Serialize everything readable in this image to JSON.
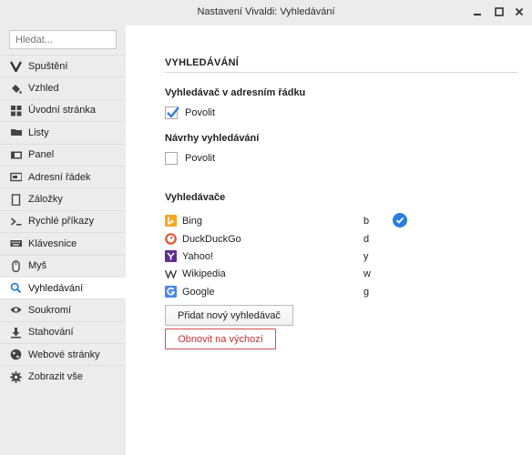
{
  "window": {
    "title": "Nastavení Vivaldi: Vyhledávání"
  },
  "search": {
    "placeholder": "Hledat..."
  },
  "sidebar": {
    "items": [
      {
        "label": "Spuštění",
        "icon": "vivaldi-icon"
      },
      {
        "label": "Vzhled",
        "icon": "paint-bucket-icon"
      },
      {
        "label": "Úvodní stránka",
        "icon": "grid-icon"
      },
      {
        "label": "Listy",
        "icon": "tabs-icon"
      },
      {
        "label": "Panel",
        "icon": "panel-icon"
      },
      {
        "label": "Adresní řádek",
        "icon": "address-bar-icon"
      },
      {
        "label": "Záložky",
        "icon": "bookmark-icon"
      },
      {
        "label": "Rychlé příkazy",
        "icon": "quick-commands-icon"
      },
      {
        "label": "Klávesnice",
        "icon": "keyboard-icon"
      },
      {
        "label": "Myš",
        "icon": "mouse-icon"
      },
      {
        "label": "Vyhledávání",
        "icon": "search-icon",
        "active": true
      },
      {
        "label": "Soukromí",
        "icon": "eye-icon"
      },
      {
        "label": "Stahování",
        "icon": "download-icon"
      },
      {
        "label": "Webové stránky",
        "icon": "globe-icon"
      },
      {
        "label": "Zobrazit vše",
        "icon": "gear-icon"
      }
    ]
  },
  "main": {
    "section_title": "VYHLEDÁVÁNÍ",
    "address_bar": {
      "heading": "Vyhledávač v adresním řádku",
      "checkbox_label": "Povolit",
      "checked": true
    },
    "suggestions": {
      "heading": "Návrhy vyhledávání",
      "checkbox_label": "Povolit",
      "checked": false
    },
    "engines": {
      "heading": "Vyhledávače",
      "list": [
        {
          "name": "Bing",
          "keyword": "b",
          "icon": "bing-icon",
          "color": "#f5a623",
          "default": true
        },
        {
          "name": "DuckDuckGo",
          "keyword": "d",
          "icon": "duckduckgo-icon",
          "color": "#de5833"
        },
        {
          "name": "Yahoo!",
          "keyword": "y",
          "icon": "yahoo-icon",
          "color": "#5f2d91"
        },
        {
          "name": "Wikipedia",
          "keyword": "w",
          "icon": "wikipedia-icon",
          "color": "#333333"
        },
        {
          "name": "Google",
          "keyword": "g",
          "icon": "google-icon",
          "color": "#4a86e8"
        }
      ]
    },
    "add_button": "Přidat nový vyhledávač",
    "reset_button": "Obnovit na výchozí"
  },
  "colors": {
    "accent": "#2a7fe0",
    "danger": "#c03030"
  }
}
